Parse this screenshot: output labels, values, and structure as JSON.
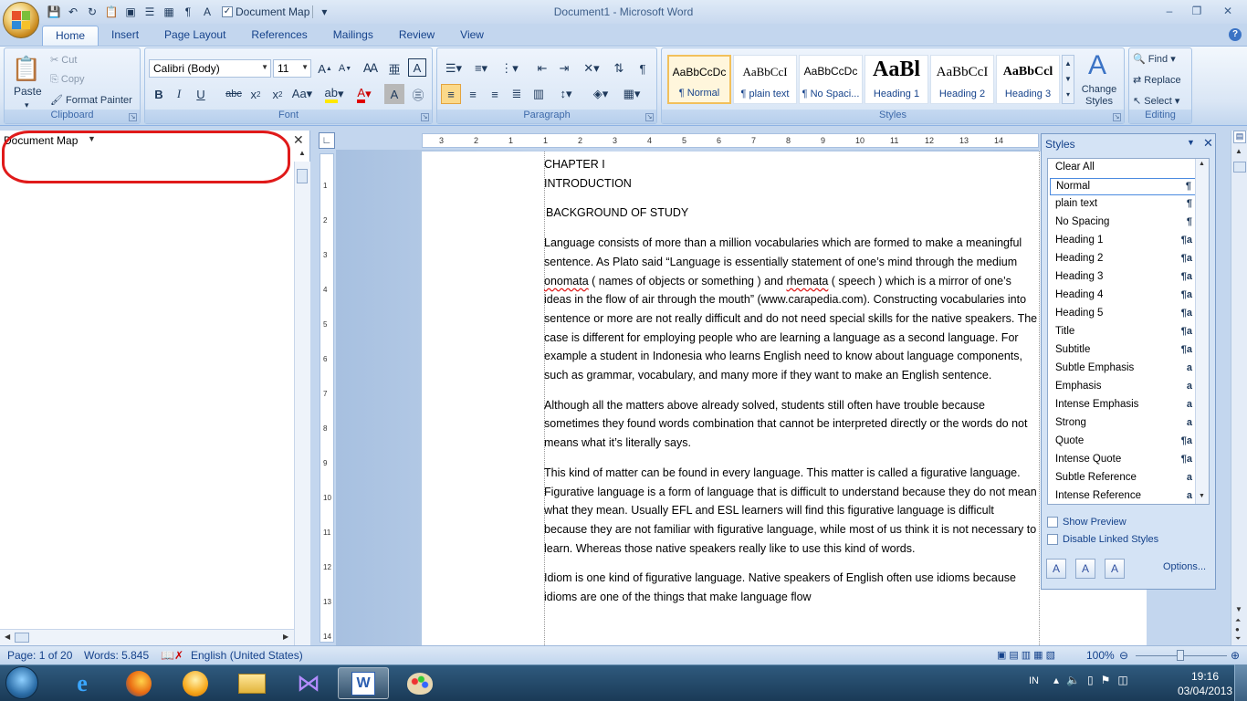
{
  "window": {
    "title": "Document1 - Microsoft Word"
  },
  "qat": {
    "document_map_label": "Document Map"
  },
  "tabs": [
    "Home",
    "Insert",
    "Page Layout",
    "References",
    "Mailings",
    "Review",
    "View"
  ],
  "clipboard": {
    "paste": "Paste",
    "cut": "Cut",
    "copy": "Copy",
    "format_painter": "Format Painter",
    "label": "Clipboard"
  },
  "font": {
    "name": "Calibri (Body)",
    "size": "11",
    "label": "Font"
  },
  "paragraph": {
    "label": "Paragraph"
  },
  "styles_gallery": {
    "label": "Styles",
    "items": [
      {
        "sample": "AaBbCcDc",
        "name": "¶ Normal"
      },
      {
        "sample": "AaBbCcI",
        "name": "¶ plain text"
      },
      {
        "sample": "AaBbCcDc",
        "name": "¶ No Spaci..."
      },
      {
        "sample": "AaBl",
        "name": "Heading 1"
      },
      {
        "sample": "AaBbCcI",
        "name": "Heading 2"
      },
      {
        "sample": "AaBbCcl",
        "name": "Heading 3"
      }
    ],
    "change_styles": "Change Styles"
  },
  "editing": {
    "find": "Find",
    "replace": "Replace",
    "select": "Select",
    "label": "Editing"
  },
  "nav_pane": {
    "title": "Document Map"
  },
  "document": {
    "chapter": "CHAPTER I",
    "introduction": "INTRODUCTION",
    "heading": "BACKGROUND OF STUDY",
    "p1_a": "Language consists of more than a million vocabularies which are formed to make a meaningful sentence. As Plato said “Language is essentially statement of one’s mind through the medium ",
    "p1_sq1": "onomata",
    "p1_b": " ( names of objects or something ) and ",
    "p1_sq2": "rhemata",
    "p1_c": " ( speech ) which is a mirror of one’s ideas in the flow of air through the mouth” (www.carapedia.com). Constructing vocabularies into sentence or more are not really difficult and do not need special skills for the native speakers. The case is different for employing people who are learning a language as a second language. For example a student in Indonesia who learns English need to know about language components, such as grammar, vocabulary, and many more if they want to make an English sentence.",
    "p2": "Although all the matters above already solved, students still often have trouble because sometimes they found words combination that cannot be interpreted directly or the words do not means what it’s literally says.",
    "p3": "This kind of matter can be found in every language. This matter is called a figurative language. Figurative language is a form of language that is difficult to understand because they do not mean what they mean. Usually EFL and ESL learners will find this figurative language is difficult because they are not familiar with figurative language, while most of us think it is not necessary to learn. Whereas those native speakers really like to use this kind of words.",
    "p4": "Idiom is one kind of figurative language. Native speakers of English often use idioms because idioms are one of the things that make language flow"
  },
  "ruler": {
    "ticks": [
      "3",
      "2",
      "1",
      "1",
      "2",
      "3",
      "4",
      "5",
      "6",
      "7",
      "8",
      "9",
      "10",
      "11",
      "12",
      "13",
      "14"
    ],
    "vticks": [
      "1",
      "2",
      "3",
      "4",
      "5",
      "6",
      "7",
      "8",
      "9",
      "10",
      "11",
      "12",
      "13",
      "14"
    ]
  },
  "styles_pane": {
    "title": "Styles",
    "items": [
      {
        "name": "Clear All",
        "mark": ""
      },
      {
        "name": "Normal",
        "mark": "¶"
      },
      {
        "name": "plain text",
        "mark": "¶"
      },
      {
        "name": "No Spacing",
        "mark": "¶"
      },
      {
        "name": "Heading 1",
        "mark": "¶a"
      },
      {
        "name": "Heading 2",
        "mark": "¶a"
      },
      {
        "name": "Heading 3",
        "mark": "¶a"
      },
      {
        "name": "Heading 4",
        "mark": "¶a"
      },
      {
        "name": "Heading 5",
        "mark": "¶a"
      },
      {
        "name": "Title",
        "mark": "¶a"
      },
      {
        "name": "Subtitle",
        "mark": "¶a"
      },
      {
        "name": "Subtle Emphasis",
        "mark": "a"
      },
      {
        "name": "Emphasis",
        "mark": "a"
      },
      {
        "name": "Intense Emphasis",
        "mark": "a"
      },
      {
        "name": "Strong",
        "mark": "a"
      },
      {
        "name": "Quote",
        "mark": "¶a"
      },
      {
        "name": "Intense Quote",
        "mark": "¶a"
      },
      {
        "name": "Subtle Reference",
        "mark": "a"
      },
      {
        "name": "Intense Reference",
        "mark": "a"
      }
    ],
    "show_preview": "Show Preview",
    "disable_linked": "Disable Linked Styles",
    "options": "Options..."
  },
  "status": {
    "page": "Page: 1 of 20",
    "words": "Words: 5.845",
    "language": "English (United States)",
    "zoom": "100%"
  },
  "taskbar": {
    "lang": "IN",
    "time": "19:16",
    "date": "03/04/2013"
  },
  "colors": {
    "highlight": "#e01a1a",
    "accent": "#15428b"
  }
}
